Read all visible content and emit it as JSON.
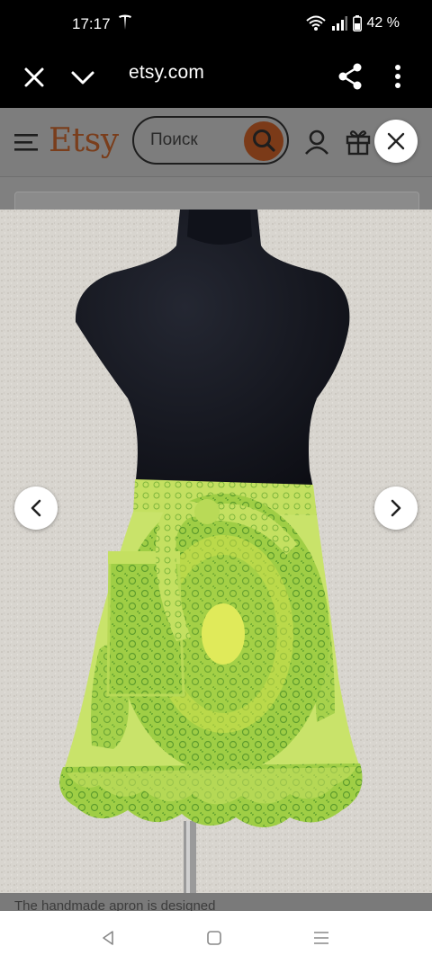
{
  "status_bar": {
    "time": "17:17",
    "battery": "42 %",
    "icons": [
      "tesla-icon",
      "wifi-icon",
      "signal-icon",
      "battery-icon"
    ]
  },
  "browser": {
    "url": "etsy.com",
    "icons": [
      "close-icon",
      "chevron-down-icon",
      "share-icon",
      "more-vert-icon"
    ]
  },
  "etsy_header": {
    "logo": "Etsy",
    "search_placeholder": "Поиск",
    "accent_color": "#f1641e",
    "icons": [
      "menu-icon",
      "search-icon",
      "user-icon",
      "gift-icon"
    ]
  },
  "gallery": {
    "close_icon": "close-icon",
    "prev_icon": "chevron-left-icon",
    "next_icon": "chevron-right-icon",
    "image_subject": "green paisley print half apron with ruffle hem on black mannequin"
  },
  "below_fold_text": "The handmade apron is designed",
  "android_nav": {
    "icons": [
      "back-icon",
      "home-icon",
      "recents-icon"
    ]
  }
}
